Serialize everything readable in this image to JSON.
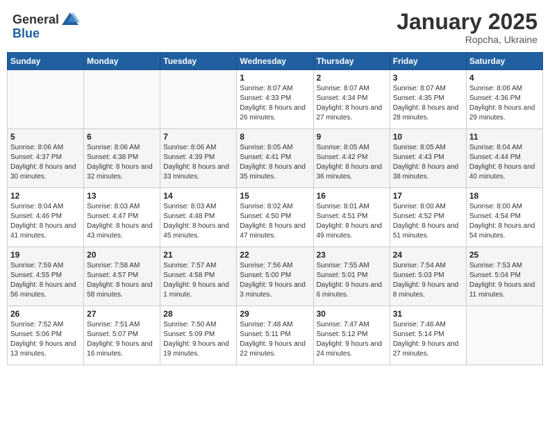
{
  "header": {
    "logo_general": "General",
    "logo_blue": "Blue",
    "month": "January 2025",
    "location": "Ropcha, Ukraine"
  },
  "weekdays": [
    "Sunday",
    "Monday",
    "Tuesday",
    "Wednesday",
    "Thursday",
    "Friday",
    "Saturday"
  ],
  "weeks": [
    [
      {
        "day": "",
        "info": ""
      },
      {
        "day": "",
        "info": ""
      },
      {
        "day": "",
        "info": ""
      },
      {
        "day": "1",
        "info": "Sunrise: 8:07 AM\nSunset: 4:33 PM\nDaylight: 8 hours and 26 minutes."
      },
      {
        "day": "2",
        "info": "Sunrise: 8:07 AM\nSunset: 4:34 PM\nDaylight: 8 hours and 27 minutes."
      },
      {
        "day": "3",
        "info": "Sunrise: 8:07 AM\nSunset: 4:35 PM\nDaylight: 8 hours and 28 minutes."
      },
      {
        "day": "4",
        "info": "Sunrise: 8:06 AM\nSunset: 4:36 PM\nDaylight: 8 hours and 29 minutes."
      }
    ],
    [
      {
        "day": "5",
        "info": "Sunrise: 8:06 AM\nSunset: 4:37 PM\nDaylight: 8 hours and 30 minutes."
      },
      {
        "day": "6",
        "info": "Sunrise: 8:06 AM\nSunset: 4:38 PM\nDaylight: 8 hours and 32 minutes."
      },
      {
        "day": "7",
        "info": "Sunrise: 8:06 AM\nSunset: 4:39 PM\nDaylight: 8 hours and 33 minutes."
      },
      {
        "day": "8",
        "info": "Sunrise: 8:05 AM\nSunset: 4:41 PM\nDaylight: 8 hours and 35 minutes."
      },
      {
        "day": "9",
        "info": "Sunrise: 8:05 AM\nSunset: 4:42 PM\nDaylight: 8 hours and 36 minutes."
      },
      {
        "day": "10",
        "info": "Sunrise: 8:05 AM\nSunset: 4:43 PM\nDaylight: 8 hours and 38 minutes."
      },
      {
        "day": "11",
        "info": "Sunrise: 8:04 AM\nSunset: 4:44 PM\nDaylight: 8 hours and 40 minutes."
      }
    ],
    [
      {
        "day": "12",
        "info": "Sunrise: 8:04 AM\nSunset: 4:46 PM\nDaylight: 8 hours and 41 minutes."
      },
      {
        "day": "13",
        "info": "Sunrise: 8:03 AM\nSunset: 4:47 PM\nDaylight: 8 hours and 43 minutes."
      },
      {
        "day": "14",
        "info": "Sunrise: 8:03 AM\nSunset: 4:48 PM\nDaylight: 8 hours and 45 minutes."
      },
      {
        "day": "15",
        "info": "Sunrise: 8:02 AM\nSunset: 4:50 PM\nDaylight: 8 hours and 47 minutes."
      },
      {
        "day": "16",
        "info": "Sunrise: 8:01 AM\nSunset: 4:51 PM\nDaylight: 8 hours and 49 minutes."
      },
      {
        "day": "17",
        "info": "Sunrise: 8:00 AM\nSunset: 4:52 PM\nDaylight: 8 hours and 51 minutes."
      },
      {
        "day": "18",
        "info": "Sunrise: 8:00 AM\nSunset: 4:54 PM\nDaylight: 8 hours and 54 minutes."
      }
    ],
    [
      {
        "day": "19",
        "info": "Sunrise: 7:59 AM\nSunset: 4:55 PM\nDaylight: 8 hours and 56 minutes."
      },
      {
        "day": "20",
        "info": "Sunrise: 7:58 AM\nSunset: 4:57 PM\nDaylight: 8 hours and 58 minutes."
      },
      {
        "day": "21",
        "info": "Sunrise: 7:57 AM\nSunset: 4:58 PM\nDaylight: 9 hours and 1 minute."
      },
      {
        "day": "22",
        "info": "Sunrise: 7:56 AM\nSunset: 5:00 PM\nDaylight: 9 hours and 3 minutes."
      },
      {
        "day": "23",
        "info": "Sunrise: 7:55 AM\nSunset: 5:01 PM\nDaylight: 9 hours and 6 minutes."
      },
      {
        "day": "24",
        "info": "Sunrise: 7:54 AM\nSunset: 5:03 PM\nDaylight: 9 hours and 8 minutes."
      },
      {
        "day": "25",
        "info": "Sunrise: 7:53 AM\nSunset: 5:04 PM\nDaylight: 9 hours and 11 minutes."
      }
    ],
    [
      {
        "day": "26",
        "info": "Sunrise: 7:52 AM\nSunset: 5:06 PM\nDaylight: 9 hours and 13 minutes."
      },
      {
        "day": "27",
        "info": "Sunrise: 7:51 AM\nSunset: 5:07 PM\nDaylight: 9 hours and 16 minutes."
      },
      {
        "day": "28",
        "info": "Sunrise: 7:50 AM\nSunset: 5:09 PM\nDaylight: 9 hours and 19 minutes."
      },
      {
        "day": "29",
        "info": "Sunrise: 7:48 AM\nSunset: 5:11 PM\nDaylight: 9 hours and 22 minutes."
      },
      {
        "day": "30",
        "info": "Sunrise: 7:47 AM\nSunset: 5:12 PM\nDaylight: 9 hours and 24 minutes."
      },
      {
        "day": "31",
        "info": "Sunrise: 7:46 AM\nSunset: 5:14 PM\nDaylight: 9 hours and 27 minutes."
      },
      {
        "day": "",
        "info": ""
      }
    ]
  ]
}
